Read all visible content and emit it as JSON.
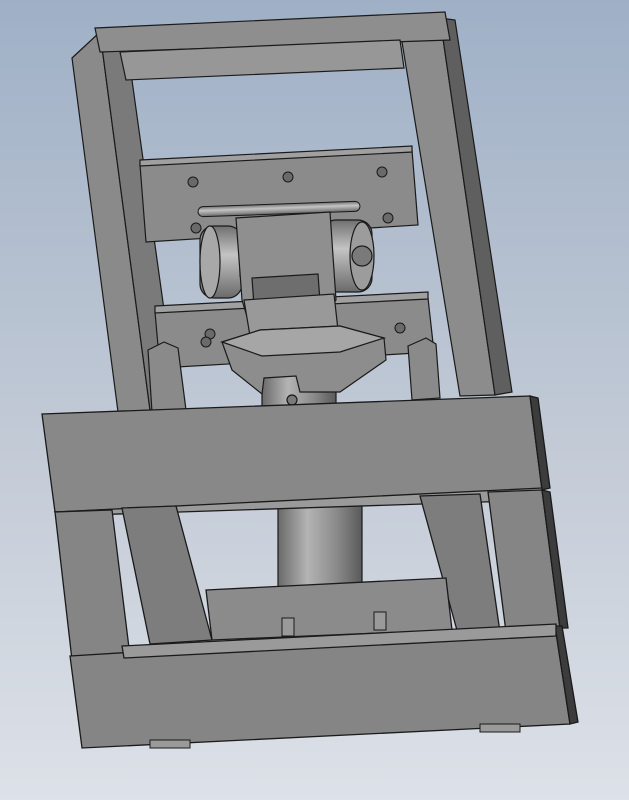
{
  "scene": {
    "subject": "cad-assembly-model",
    "colors": {
      "background_top": "#9fb0c6",
      "background_bottom": "#dde1e8",
      "metal_light": "#9a9a9a",
      "metal_mid": "#858585",
      "metal_dark": "#5e5e5e",
      "edge": "#1a1a1a"
    },
    "icons": [
      "bolt-hole-icon"
    ]
  }
}
